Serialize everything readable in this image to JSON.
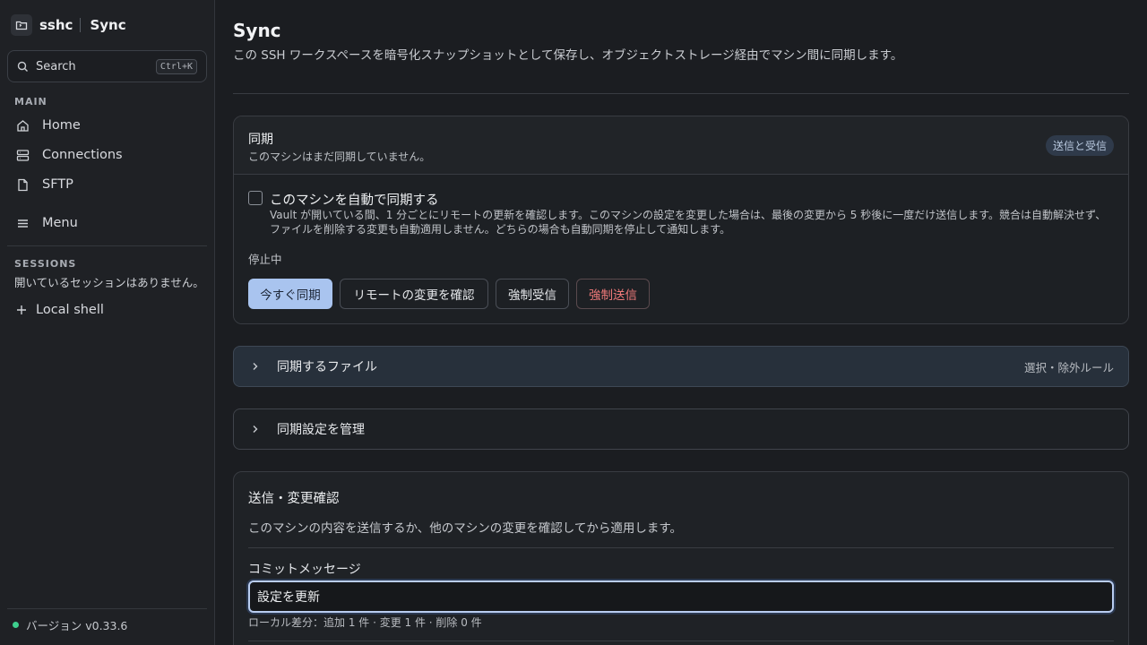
{
  "app": {
    "name": "sshc",
    "page": "Sync"
  },
  "sidebar": {
    "search": {
      "label": "Search",
      "shortcut": "Ctrl+K"
    },
    "main_title": "MAIN",
    "items": [
      {
        "label": "Home",
        "icon": "home-icon"
      },
      {
        "label": "Connections",
        "icon": "server-icon"
      },
      {
        "label": "SFTP",
        "icon": "file-icon"
      }
    ],
    "menu_label": "Menu",
    "sessions_title": "SESSIONS",
    "sessions_empty": "開いているセッションはありません。",
    "local_shell": "Local shell",
    "version": "バージョン v0.33.6"
  },
  "header": {
    "title": "Sync",
    "description": "この SSH ワークスペースを暗号化スナップショットとして保存し、オブジェクトストレージ経由でマシン間に同期します。"
  },
  "sync_card": {
    "title": "同期",
    "subtitle": "このマシンはまだ同期していません。",
    "badge": "送信と受信",
    "auto_label": "このマシンを自動で同期する",
    "auto_checked": false,
    "auto_description": "Vault が開いている間、1 分ごとにリモートの更新を確認します。このマシンの設定を変更した場合は、最後の変更から 5 秒後に一度だけ送信します。競合は自動解決せず、ファイルを削除する変更も自動適用しません。どちらの場合も自動同期を停止して通知します。",
    "status": "停止中",
    "buttons": {
      "sync_now": "今すぐ同期",
      "check_remote": "リモートの変更を確認",
      "force_pull": "強制受信",
      "force_push": "強制送信"
    }
  },
  "files_section": {
    "label": "同期するファイル",
    "hint": "選択・除外ルール"
  },
  "settings_section": {
    "label": "同期設定を管理"
  },
  "send_card": {
    "title": "送信・変更確認",
    "description": "このマシンの内容を送信するか、他のマシンの変更を確認してから適用します。",
    "commit_label": "コミットメッセージ",
    "commit_value": "設定を更新",
    "diff_summary": "ローカル差分：追加 1 件 · 変更 1 件 · 削除 0 件"
  },
  "colors": {
    "accent": "#a9c4ef",
    "danger": "#f07a7a",
    "status_dot": "#3ecf8e"
  }
}
